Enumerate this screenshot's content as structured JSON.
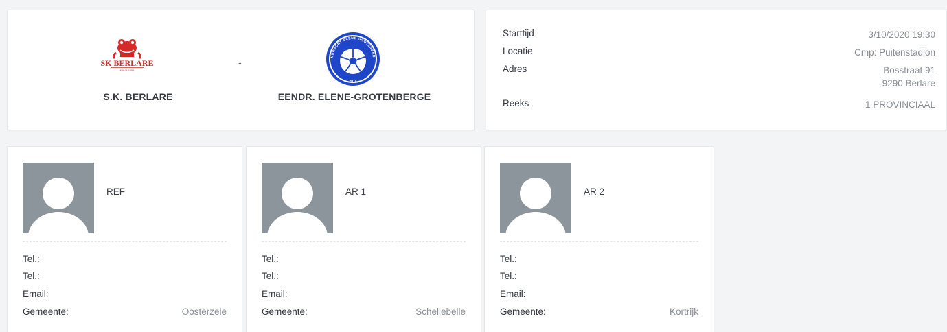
{
  "match": {
    "home_team": "S.K. BERLARE",
    "home_logo_text": "SK BERLARE",
    "home_logo_subtext": "KBVB 7856",
    "separator": "-",
    "away_team": "EENDR. ELENE-GROTENBERGE",
    "away_logo_text": "EENDRACHT ELENE GROTENBERGE",
    "away_logo_year": "2014"
  },
  "info": {
    "start_label": "Starttijd",
    "start_value": "3/10/2020 19:30",
    "location_label": "Locatie",
    "location_value": "Cmp: Puitenstadion",
    "address_label": "Adres",
    "address_line1": "Bosstraat 91",
    "address_line2": "9290 Berlare",
    "series_label": "Reeks",
    "series_value": "1 PROVINCIAAL"
  },
  "officials": [
    {
      "role": "REF",
      "tel1_label": "Tel.:",
      "tel2_label": "Tel.:",
      "email_label": "Email:",
      "municipality_label": "Gemeente:",
      "municipality": "Oosterzele"
    },
    {
      "role": "AR 1",
      "tel1_label": "Tel.:",
      "tel2_label": "Tel.:",
      "email_label": "Email:",
      "municipality_label": "Gemeente:",
      "municipality": "Schellebelle"
    },
    {
      "role": "AR 2",
      "tel1_label": "Tel.:",
      "tel2_label": "Tel.:",
      "email_label": "Email:",
      "municipality_label": "Gemeente:",
      "municipality": "Kortrijk"
    }
  ],
  "colors": {
    "home_red": "#d42a2a",
    "away_blue": "#1f45c8",
    "avatar_gray": "#8d959c",
    "value_gray": "#8a8f96"
  },
  "icons": {
    "home_logo": "sk-berlare-frog-logo",
    "away_logo": "elene-grotenberge-football-logo",
    "avatar": "person-placeholder-icon"
  }
}
